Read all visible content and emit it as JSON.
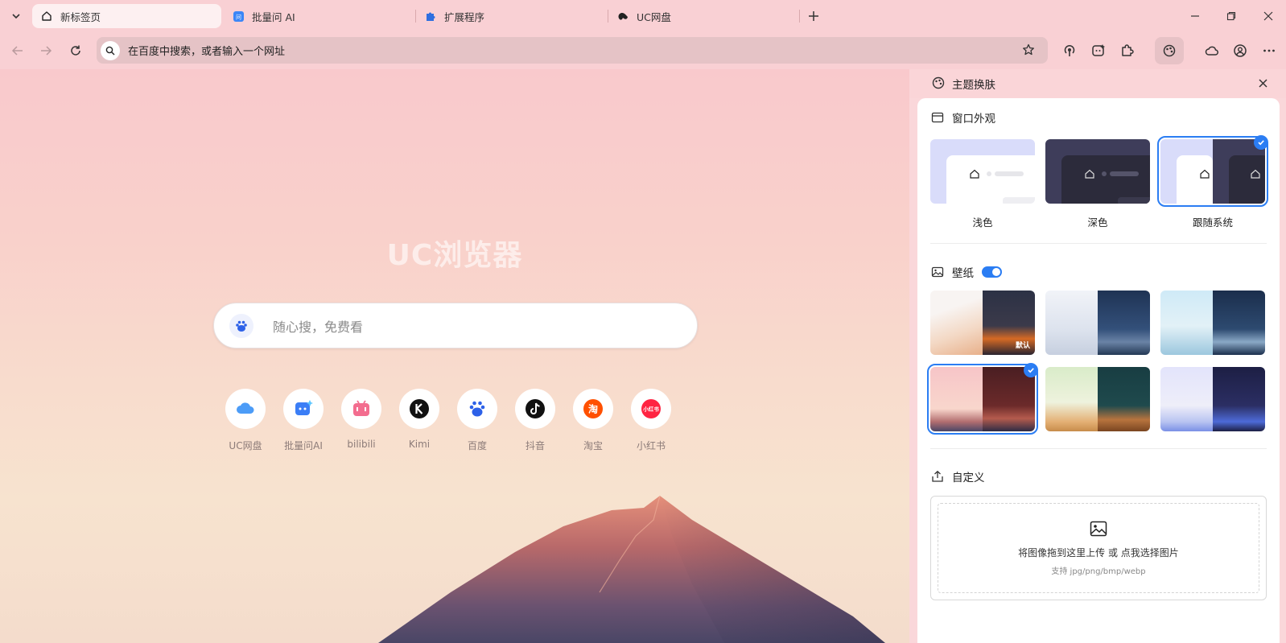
{
  "tabs": [
    {
      "title": "新标签页",
      "icon": "home-icon",
      "active": true
    },
    {
      "title": "批量问 AI",
      "icon": "ai-chat-icon",
      "active": false
    },
    {
      "title": "扩展程序",
      "icon": "puzzle-icon",
      "active": false
    },
    {
      "title": "UC网盘",
      "icon": "uc-drive-icon",
      "active": false
    }
  ],
  "omnibox": {
    "placeholder": "在百度中搜索，或者输入一个网址"
  },
  "ntp": {
    "brand": "UC浏览器",
    "search_placeholder": "随心搜，免费看",
    "shortcuts": [
      {
        "label": "UC网盘",
        "icon": "uc-cloud-icon",
        "color": "#3b8ff5"
      },
      {
        "label": "批量问AI",
        "icon": "batch-ai-icon",
        "color": "#3b7ef6"
      },
      {
        "label": "bilibili",
        "icon": "bilibili-icon",
        "color": "#f36d8f"
      },
      {
        "label": "Kimi",
        "icon": "kimi-icon",
        "color": "#111111"
      },
      {
        "label": "百度",
        "icon": "baidu-icon",
        "color": "#2d61e8"
      },
      {
        "label": "抖音",
        "icon": "douyin-icon",
        "color": "#111111"
      },
      {
        "label": "淘宝",
        "icon": "taobao-icon",
        "color": "#ff5000"
      },
      {
        "label": "小红书",
        "icon": "xiaohongshu-icon",
        "color": "#ff2442"
      }
    ]
  },
  "theme_panel": {
    "title": "主题换肤",
    "appearance": {
      "heading": "窗口外观",
      "options": [
        {
          "label": "浅色",
          "selected": false
        },
        {
          "label": "深色",
          "selected": false
        },
        {
          "label": "跟随系统",
          "selected": true
        }
      ]
    },
    "wallpaper": {
      "heading": "壁纸",
      "enabled": true,
      "default_badge": "默认",
      "selected_index": 3
    },
    "custom": {
      "heading": "自定义",
      "upload_text": "将图像拖到这里上传 或 点我选择图片",
      "formats": "支持 jpg/png/bmp/webp"
    }
  },
  "colors": {
    "accent": "#2b7df3",
    "chrome": "#f9d0d4",
    "omnibox": "#e5c3c6"
  }
}
